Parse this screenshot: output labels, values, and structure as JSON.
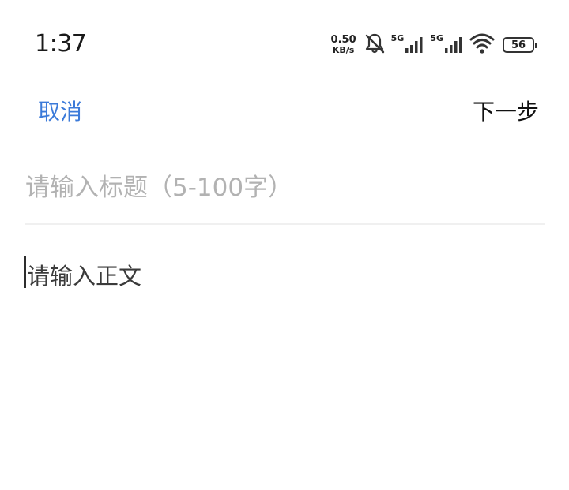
{
  "status_bar": {
    "time": "1:37",
    "net_speed_value": "0.50",
    "net_speed_unit": "KB/s",
    "sim1_label": "5G",
    "sim2_label": "5G",
    "battery_level": "56"
  },
  "nav": {
    "cancel_label": "取消",
    "next_label": "下一步"
  },
  "editor": {
    "title_placeholder": "请输入标题（5-100字）",
    "body_placeholder": "请输入正文"
  },
  "colors": {
    "accent": "#3b7ad9",
    "placeholder": "#b2b2b2",
    "divider": "#f0f0f0"
  }
}
